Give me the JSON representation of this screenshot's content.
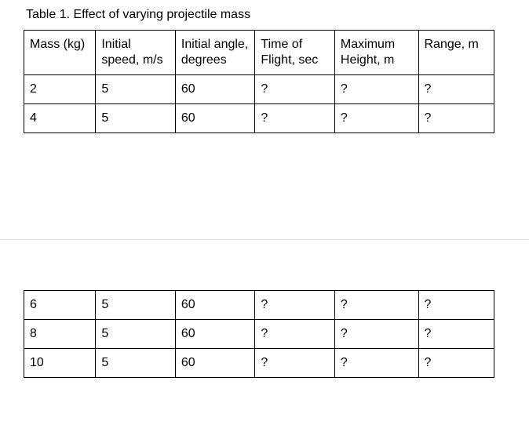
{
  "title": "Table 1. Effect of varying projectile mass",
  "headers": {
    "mass": "Mass (kg)",
    "speed": "Initial speed, m/s",
    "angle": "Initial angle, degrees",
    "time": "Time of Flight, sec",
    "height": "Maximum Height, m",
    "range": "Range, m"
  },
  "rows": [
    {
      "mass": "2",
      "speed": "5",
      "angle": "60",
      "time": "?",
      "height": "?",
      "range": "?"
    },
    {
      "mass": "4",
      "speed": "5",
      "angle": "60",
      "time": "?",
      "height": "?",
      "range": "?"
    },
    {
      "mass": "6",
      "speed": "5",
      "angle": "60",
      "time": "?",
      "height": "?",
      "range": "?"
    },
    {
      "mass": "8",
      "speed": "5",
      "angle": "60",
      "time": "?",
      "height": "?",
      "range": "?"
    },
    {
      "mass": "10",
      "speed": "5",
      "angle": "60",
      "time": "?",
      "height": "?",
      "range": "?"
    }
  ]
}
